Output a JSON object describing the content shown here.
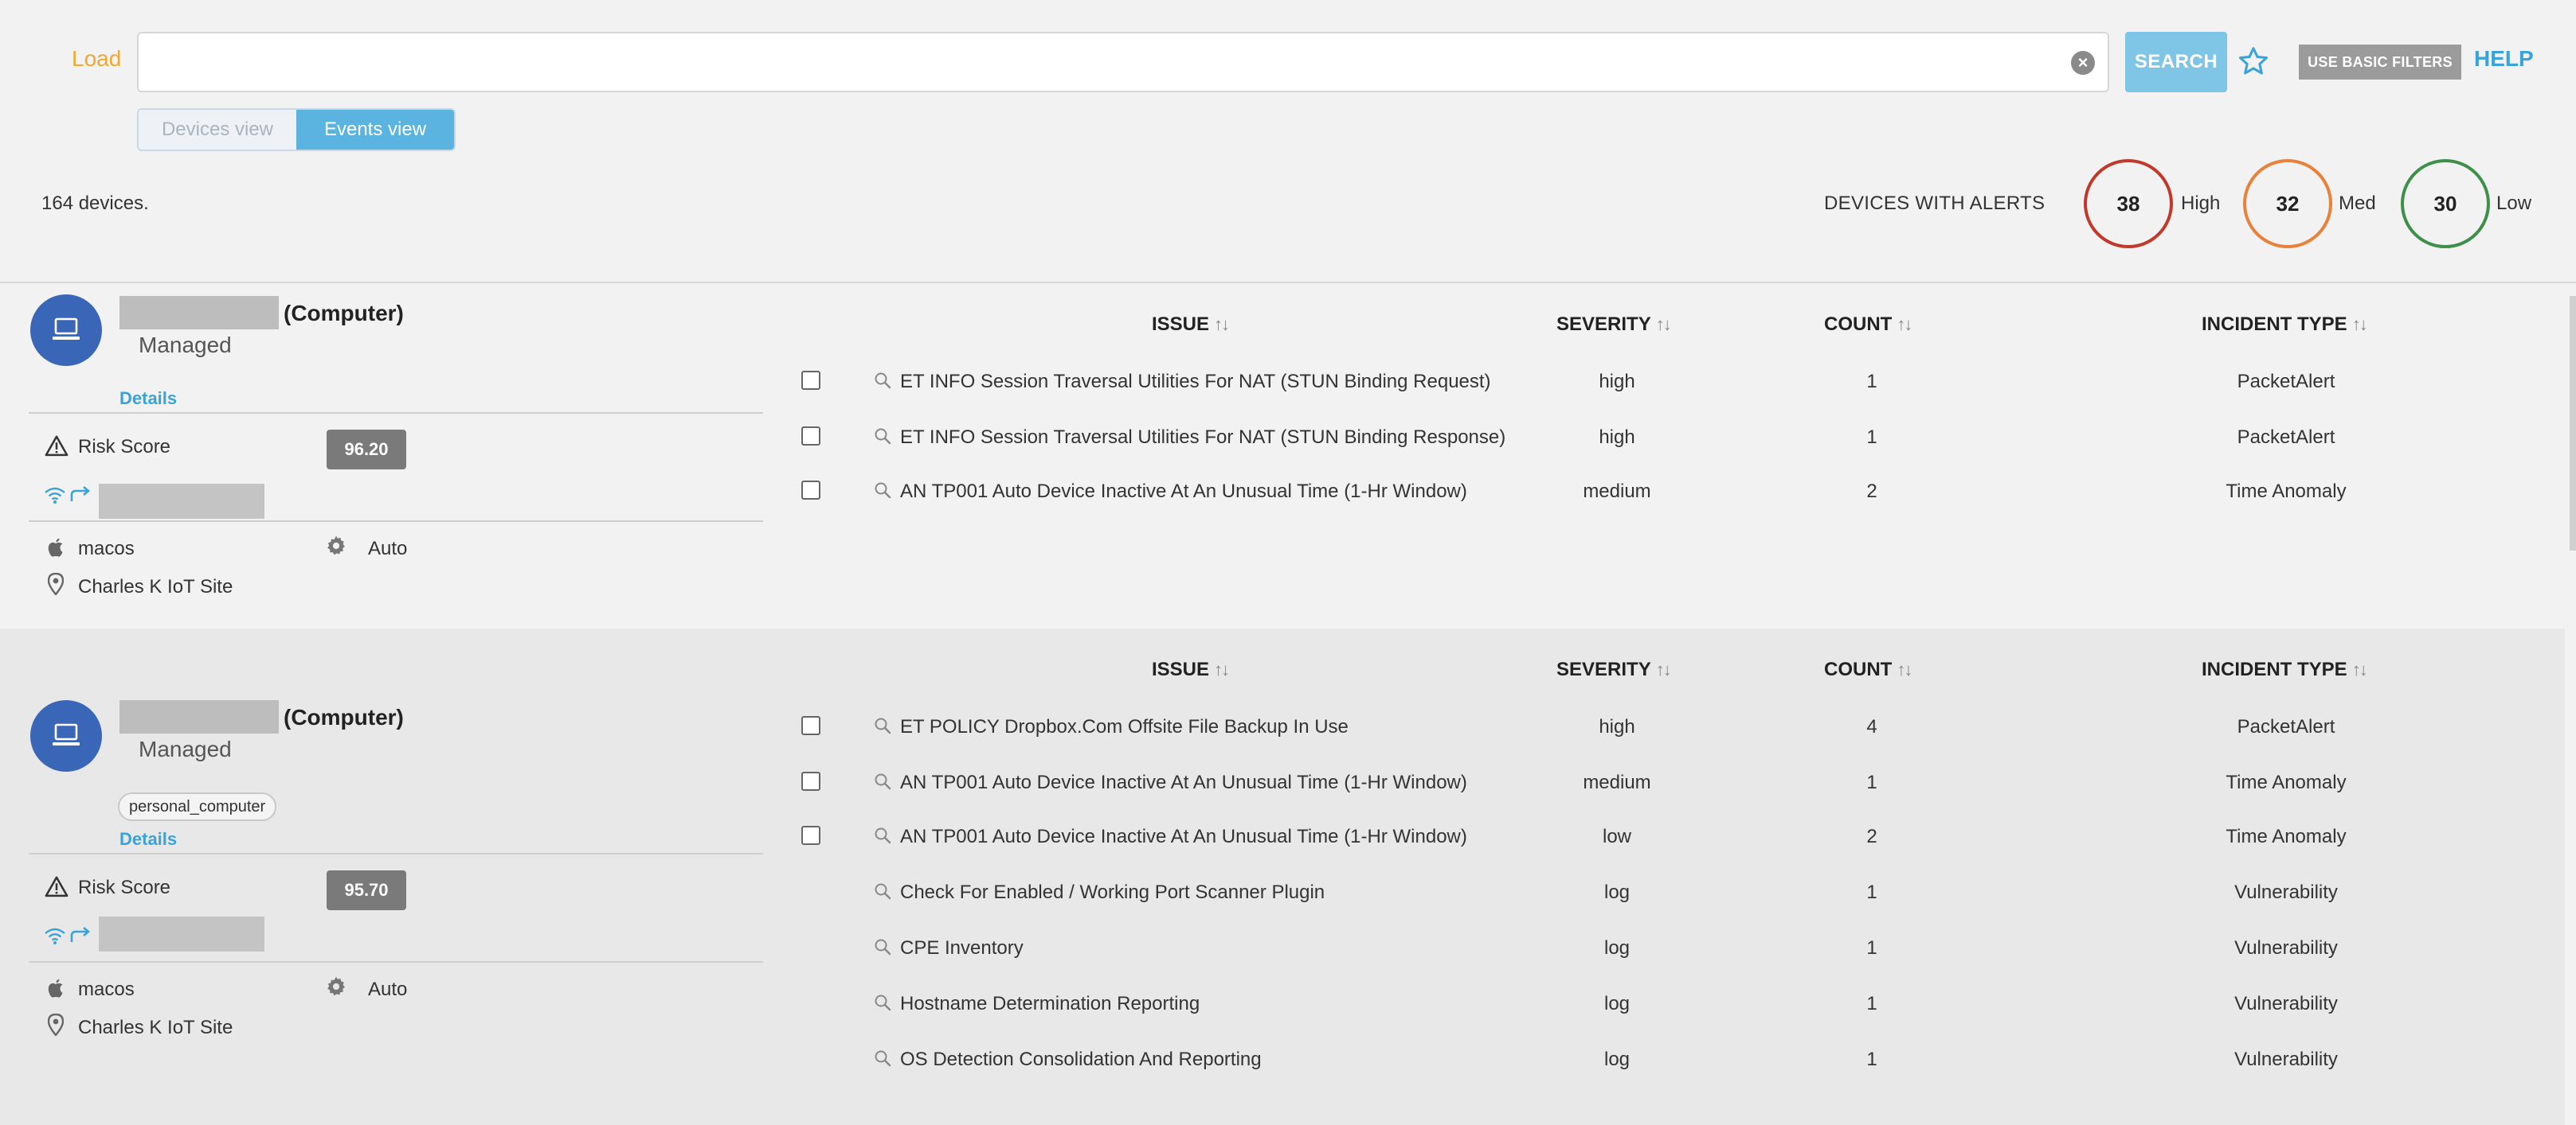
{
  "toolbar": {
    "load_label": "Load",
    "search_value": "",
    "search_label": "SEARCH",
    "basic_filters_label": "USE BASIC FILTERS",
    "help_label": "HELP"
  },
  "view_toggle": {
    "devices_label": "Devices view",
    "events_label": "Events view",
    "selected": "Events view"
  },
  "summary": {
    "device_count": "164 devices.",
    "alerts_label": "DEVICES WITH ALERTS",
    "high_count": "38",
    "high_label": "High",
    "med_count": "32",
    "med_label": "Med",
    "low_count": "30",
    "low_label": "Low"
  },
  "colors": {
    "high": "#c0392b",
    "med": "#e8823a",
    "low": "#3d8f4a",
    "accent": "#3aa3d8",
    "avatar": "#3a66b8",
    "load": "#f0a830"
  },
  "columns": {
    "issue": "ISSUE",
    "severity": "SEVERITY",
    "count": "COUNT",
    "incident_type": "INCIDENT TYPE",
    "sort_glyph": "↑↓"
  },
  "devices": [
    {
      "name_suffix": "(Computer)",
      "status": "Managed",
      "tag": "",
      "details_label": "Details",
      "risk_label": "Risk Score",
      "risk_score": "96.20",
      "os": "macos",
      "mode": "Auto",
      "site": "Charles K IoT Site",
      "icons": [
        "laptop-icon",
        "warning-icon",
        "wifi-icon",
        "link-icon",
        "apple-icon",
        "gear-icon",
        "pin-icon"
      ],
      "events": [
        {
          "issue": "ET INFO Session Traversal Utilities For NAT (STUN Binding Request)",
          "severity": "high",
          "count": "1",
          "type": "PacketAlert",
          "checkbox": true
        },
        {
          "issue": "ET INFO Session Traversal Utilities For NAT (STUN Binding Response)",
          "severity": "high",
          "count": "1",
          "type": "PacketAlert",
          "checkbox": true
        },
        {
          "issue": "AN TP001 Auto Device Inactive At An Unusual Time (1-Hr Window)",
          "severity": "medium",
          "count": "2",
          "type": "Time Anomaly",
          "checkbox": true
        }
      ]
    },
    {
      "name_suffix": "(Computer)",
      "status": "Managed",
      "tag": "personal_computer",
      "details_label": "Details",
      "risk_label": "Risk Score",
      "risk_score": "95.70",
      "os": "macos",
      "mode": "Auto",
      "site": "Charles K IoT Site",
      "icons": [
        "laptop-icon",
        "warning-icon",
        "wifi-icon",
        "link-icon",
        "apple-icon",
        "gear-icon",
        "pin-icon"
      ],
      "events": [
        {
          "issue": "ET POLICY Dropbox.Com Offsite File Backup In Use",
          "severity": "high",
          "count": "4",
          "type": "PacketAlert",
          "checkbox": true
        },
        {
          "issue": "AN TP001 Auto Device Inactive At An Unusual Time (1-Hr Window)",
          "severity": "medium",
          "count": "1",
          "type": "Time Anomaly",
          "checkbox": true
        },
        {
          "issue": "AN TP001 Auto Device Inactive At An Unusual Time (1-Hr Window)",
          "severity": "low",
          "count": "2",
          "type": "Time Anomaly",
          "checkbox": true
        },
        {
          "issue": "Check For Enabled / Working Port Scanner Plugin",
          "severity": "log",
          "count": "1",
          "type": "Vulnerability",
          "checkbox": false
        },
        {
          "issue": "CPE Inventory",
          "severity": "log",
          "count": "1",
          "type": "Vulnerability",
          "checkbox": false
        },
        {
          "issue": "Hostname Determination Reporting",
          "severity": "log",
          "count": "1",
          "type": "Vulnerability",
          "checkbox": false
        },
        {
          "issue": "OS Detection Consolidation And Reporting",
          "severity": "log",
          "count": "1",
          "type": "Vulnerability",
          "checkbox": false
        }
      ]
    }
  ]
}
